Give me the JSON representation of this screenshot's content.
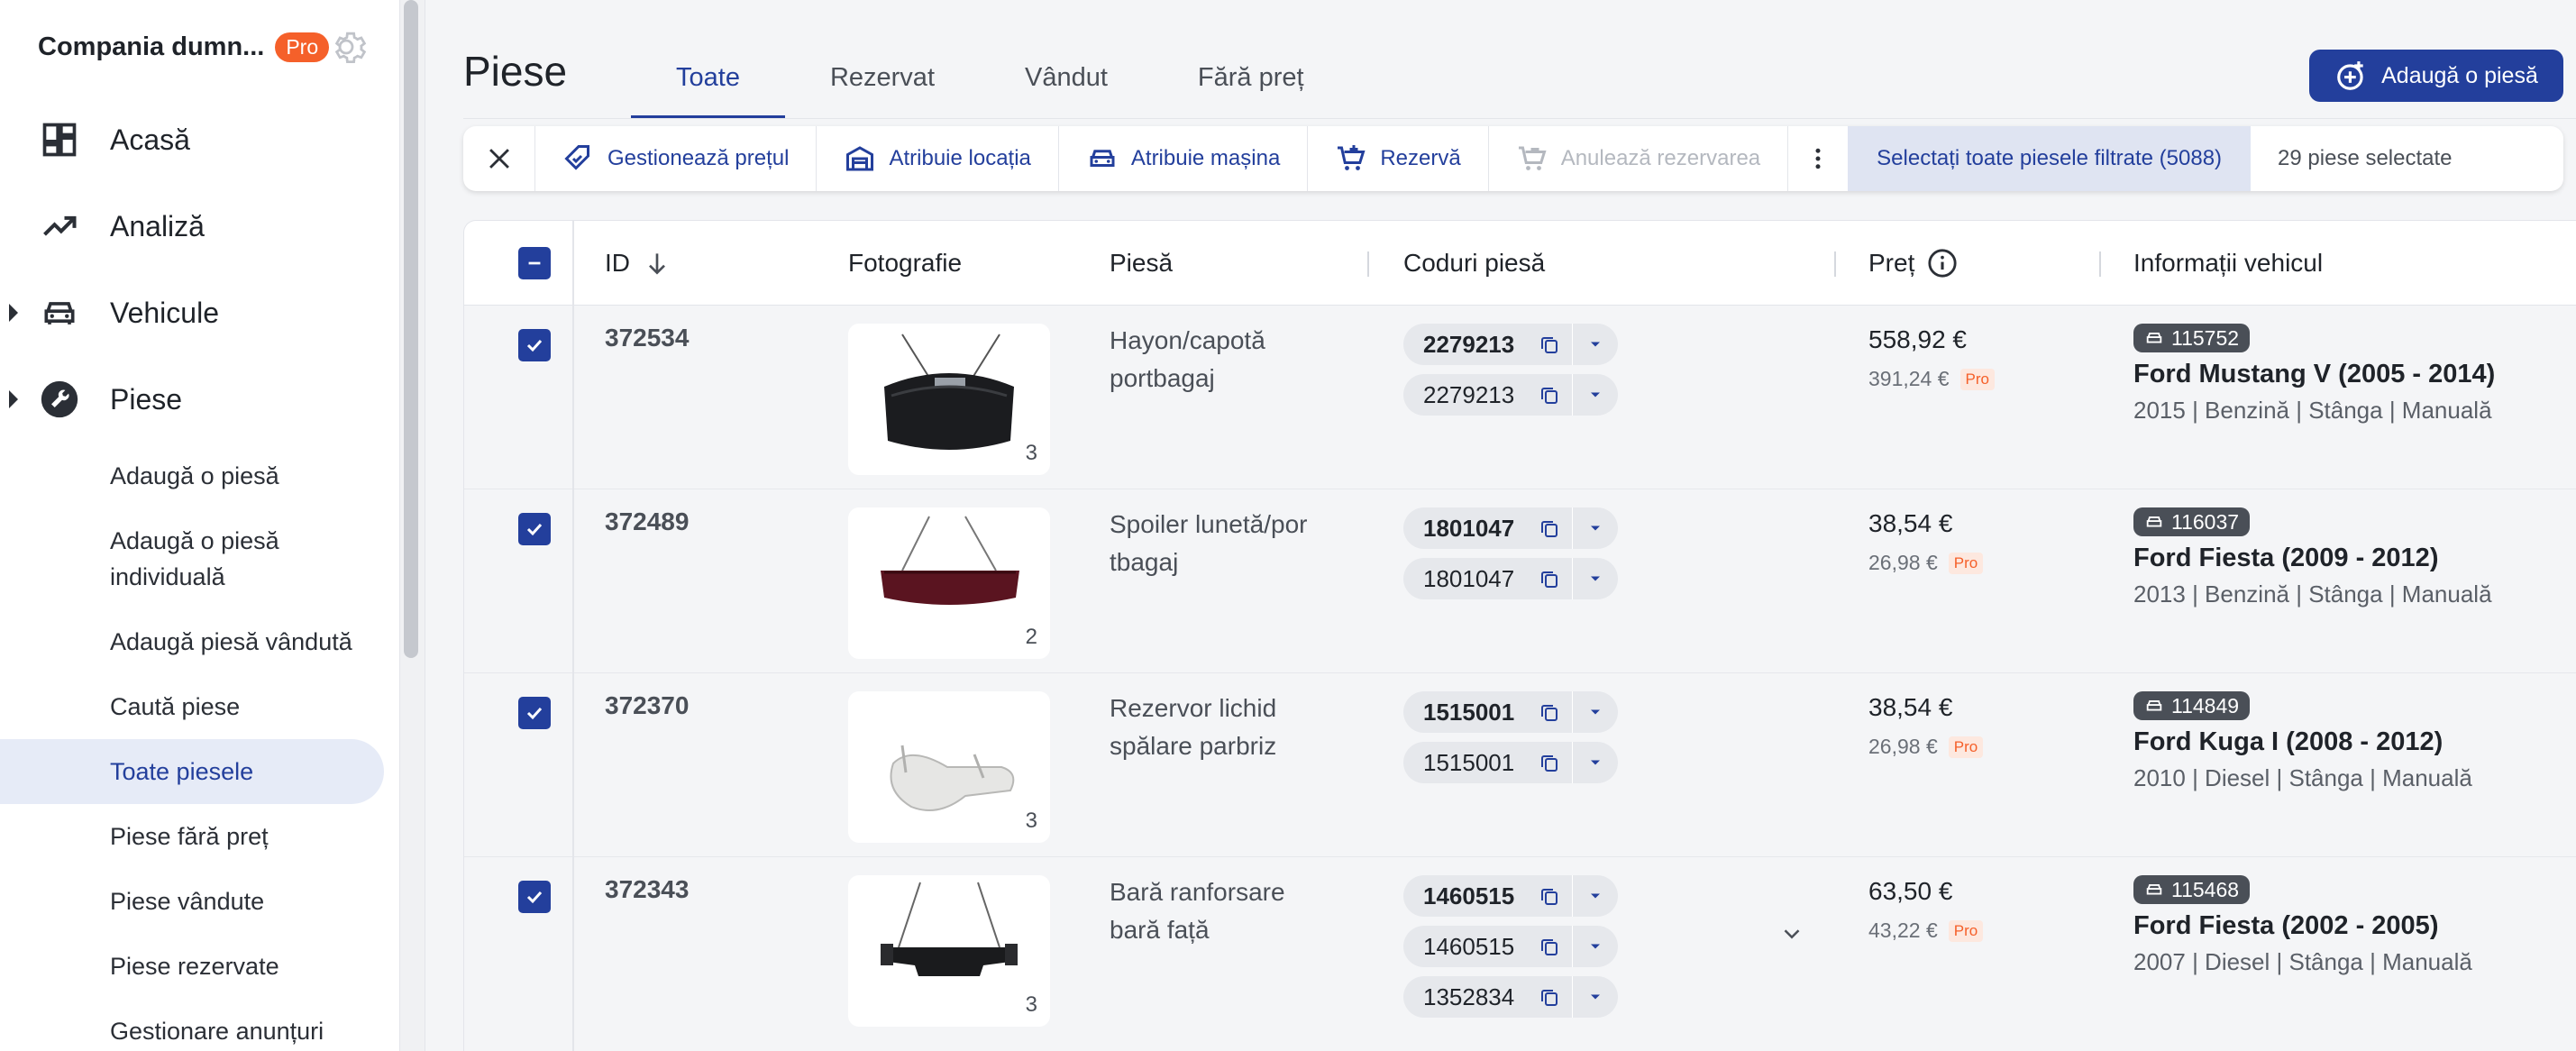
{
  "sidebar": {
    "company_name": "Compania dumn...",
    "pro_badge": "Pro",
    "main_items": [
      {
        "label": "Acasă",
        "icon": "dashboard-icon"
      },
      {
        "label": "Analiză",
        "icon": "trending-up-icon"
      },
      {
        "label": "Vehicule",
        "icon": "car-icon"
      },
      {
        "label": "Piese",
        "icon": "wrench-icon"
      }
    ],
    "sub_items": [
      "Adaugă o piesă",
      "Adaugă o piesă individuală",
      "Adaugă piesă vândută",
      "Caută piese",
      "Toate piesele",
      "Piese fără preț",
      "Piese vândute",
      "Piese rezervate",
      "Gestionare anunțuri"
    ],
    "active_sub": "Toate piesele"
  },
  "header": {
    "title": "Piese",
    "tabs": [
      "Toate",
      "Rezervat",
      "Vândut",
      "Fără preț"
    ],
    "active_tab": "Toate",
    "add_button": "Adaugă o piesă"
  },
  "action_bar": {
    "manage_price": "Gestionează prețul",
    "assign_location": "Atribuie locația",
    "assign_car": "Atribuie mașina",
    "reserve": "Rezervă",
    "cancel_reservation": "Anulează rezervarea",
    "select_all": "Selectați toate piesele filtrate (5088)",
    "selected_count": "29 piese selectate"
  },
  "table": {
    "columns": {
      "id": "ID",
      "photo": "Fotografie",
      "part": "Piesă",
      "codes": "Coduri piesă",
      "price": "Preț",
      "vehicle": "Informații vehicul"
    },
    "rows": [
      {
        "id": "372534",
        "photo_count": "3",
        "part": "Hayon/capotă portbagaj",
        "codes": [
          "2279213",
          "2279213"
        ],
        "price": "558,92 €",
        "pro_price": "391,24 €",
        "pro_tag": "Pro",
        "vehicle_id": "115752",
        "vehicle_title": "Ford Mustang V (2005 - 2014)",
        "vehicle_sub": "2015 | Benzină | Stânga | Manuală"
      },
      {
        "id": "372489",
        "photo_count": "2",
        "part": "Spoiler lunetă/portbagaj",
        "codes": [
          "1801047",
          "1801047"
        ],
        "price": "38,54 €",
        "pro_price": "26,98 €",
        "pro_tag": "Pro",
        "vehicle_id": "116037",
        "vehicle_title": "Ford Fiesta (2009 - 2012)",
        "vehicle_sub": "2013 | Benzină | Stânga | Manuală"
      },
      {
        "id": "372370",
        "photo_count": "3",
        "part": "Rezervor lichid spălare parbriz",
        "codes": [
          "1515001",
          "1515001"
        ],
        "price": "38,54 €",
        "pro_price": "26,98 €",
        "pro_tag": "Pro",
        "vehicle_id": "114849",
        "vehicle_title": "Ford Kuga I (2008 - 2012)",
        "vehicle_sub": "2010 | Diesel | Stânga | Manuală"
      },
      {
        "id": "372343",
        "photo_count": "3",
        "part": "Bară ranforsare bară față",
        "codes": [
          "1460515",
          "1460515",
          "1352834"
        ],
        "price": "63,50 €",
        "pro_price": "43,22 €",
        "pro_tag": "Pro",
        "vehicle_id": "115468",
        "vehicle_title": "Ford Fiesta (2002 - 2005)",
        "vehicle_sub": "2007 | Diesel | Stânga | Manuală"
      }
    ]
  },
  "colors": {
    "primary": "#233f9c",
    "pro": "#f5602a",
    "row_bg": "#f4f5f7"
  }
}
